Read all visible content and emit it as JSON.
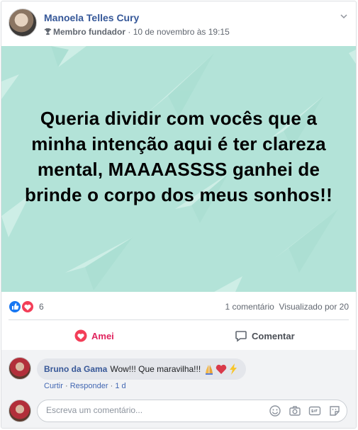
{
  "post": {
    "author": "Manoela Telles Cury",
    "badge": "Membro fundador",
    "separator": "·",
    "timestamp": "10 de novembro às 19:15",
    "text": "Queria dividir com vocês que a minha intenção aqui é ter clareza mental, MAAAASSSS ganhei de brinde o corpo dos meus sonhos!!",
    "banner_color": "#b3e3d8"
  },
  "reactions": {
    "icons": [
      "like-icon",
      "love-icon"
    ],
    "count": "6",
    "comments": "1 comentário",
    "views": "Visualizado por 20"
  },
  "actions": {
    "love": "Amei",
    "comment": "Comentar",
    "love_color": "#e0245e"
  },
  "comment": {
    "author": "Bruno da Gama",
    "text": "Wow!!! Que maravilha!!!",
    "emojis": [
      "praying-hands-icon",
      "heart-icon",
      "lightning-icon"
    ],
    "like_label": "Curtir",
    "reply_label": "Responder",
    "age": "1 d",
    "separator": "·"
  },
  "composer": {
    "placeholder": "Escreva um comentário...",
    "tools": [
      "emoji-icon",
      "camera-icon",
      "gif-icon",
      "sticker-icon"
    ]
  }
}
